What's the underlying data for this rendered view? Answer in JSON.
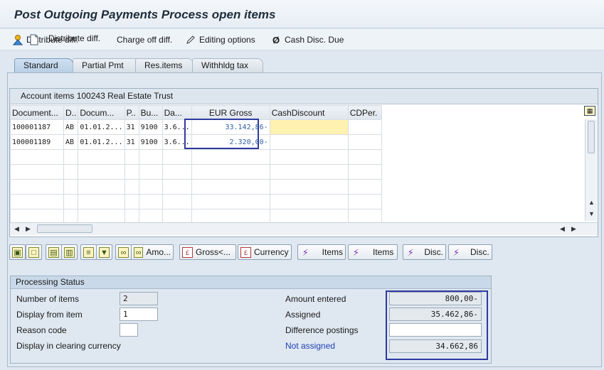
{
  "window": {
    "title": "Post Outgoing Payments Process open items"
  },
  "toolbar": {
    "items": [
      {
        "label": "Distribute diff.",
        "icon": "distribute-icon"
      },
      {
        "label": "Charge off diff.",
        "icon": "document-icon"
      },
      {
        "label": "Editing options",
        "icon": "pencil-icon"
      },
      {
        "label": "Cash Disc. Due",
        "icon": "cash-discount-icon"
      }
    ]
  },
  "tabs": [
    {
      "label": "Standard",
      "active": true
    },
    {
      "label": "Partial Pmt",
      "active": false
    },
    {
      "label": "Res.items",
      "active": false
    },
    {
      "label": "Withhldg tax",
      "active": false
    }
  ],
  "grid": {
    "title": "Account items 100243 Real Estate Trust",
    "columns": [
      "Document...",
      "D..",
      "Docum...",
      "P..",
      "Bu...",
      "Da...",
      "EUR Gross",
      "CashDiscount",
      "CDPer."
    ],
    "rows": [
      [
        "100001187",
        "AB",
        "01.01.2...",
        "31",
        "9100",
        "3.6...",
        "33.142,86-",
        "",
        ""
      ],
      [
        "100001189",
        "AB",
        "01.01.2...",
        "31",
        "9100",
        "3.6...",
        "2.320,00-",
        "",
        ""
      ]
    ],
    "empty_rows": 5
  },
  "function_buttons": [
    {
      "icon": "select-all-icon",
      "label": ""
    },
    {
      "icon": "deselect-all-icon",
      "label": ""
    },
    {
      "icon": "activate-items-icon",
      "label": ""
    },
    {
      "icon": "deactivate-items-icon",
      "label": ""
    },
    {
      "icon": "sort-ascending-icon",
      "label": ""
    },
    {
      "icon": "filter-icon",
      "label": ""
    },
    {
      "icon": "find-icon",
      "label": ""
    },
    {
      "icon": "find-amount-icon",
      "label": "Amo..."
    },
    {
      "icon": "gross-icon",
      "label": "Gross<..."
    },
    {
      "icon": "currency-icon",
      "label": "Currency"
    },
    {
      "icon": "activate-wand-icon",
      "label": "Items"
    },
    {
      "icon": "deactivate-wand-icon",
      "label": "Items"
    },
    {
      "icon": "disc-wand-icon",
      "label": "Disc."
    },
    {
      "icon": "disc-wand-2-icon",
      "label": "Disc."
    }
  ],
  "processing_status": {
    "title": "Processing Status",
    "number_of_items_label": "Number of items",
    "number_of_items": "2",
    "display_from_item_label": "Display from item",
    "display_from_item": "1",
    "reason_code_label": "Reason code",
    "reason_code": "",
    "display_clearing_label": "Display in clearing currency",
    "amount_entered_label": "Amount entered",
    "amount_entered": "800,00-",
    "assigned_label": "Assigned",
    "assigned": "35.462,86-",
    "difference_postings_label": "Difference postings",
    "difference_postings": "",
    "not_assigned_label": "Not assigned",
    "not_assigned": "34.662,86"
  }
}
